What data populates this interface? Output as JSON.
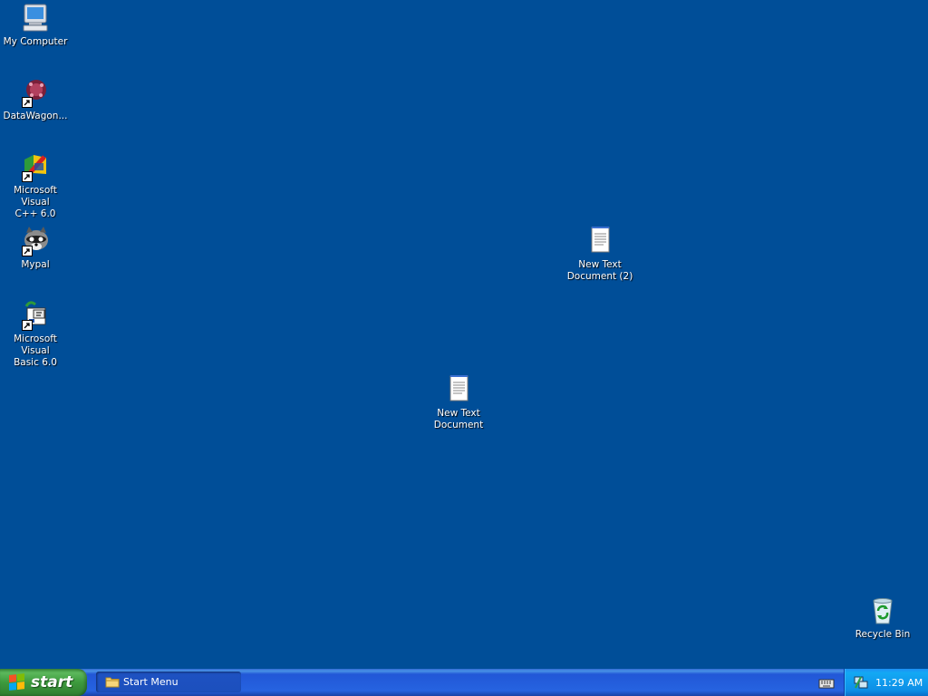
{
  "desktop": {
    "background": "#004e98",
    "icons": [
      {
        "label": "My Computer",
        "icon": "my-computer-icon"
      },
      {
        "label": "DataWagon...",
        "icon": "datawagon-icon"
      },
      {
        "label": "Microsoft Visual\nC++ 6.0",
        "icon": "visual-cpp-icon"
      },
      {
        "label": "Mypal",
        "icon": "mypal-icon"
      },
      {
        "label": "Microsoft Visual\nBasic 6.0",
        "icon": "visual-basic-icon"
      },
      {
        "label": "New Text\nDocument (2)",
        "icon": "text-document-icon"
      },
      {
        "label": "New Text\nDocument",
        "icon": "text-document-icon"
      },
      {
        "label": "Recycle Bin",
        "icon": "recycle-bin-icon"
      }
    ]
  },
  "taskbar": {
    "start_label": "start",
    "task": {
      "label": "Start Menu",
      "icon": "folder-icon"
    },
    "tray": {
      "clock": "11:29 AM",
      "icons": [
        "keyboard-icon",
        "network-icon"
      ]
    }
  }
}
